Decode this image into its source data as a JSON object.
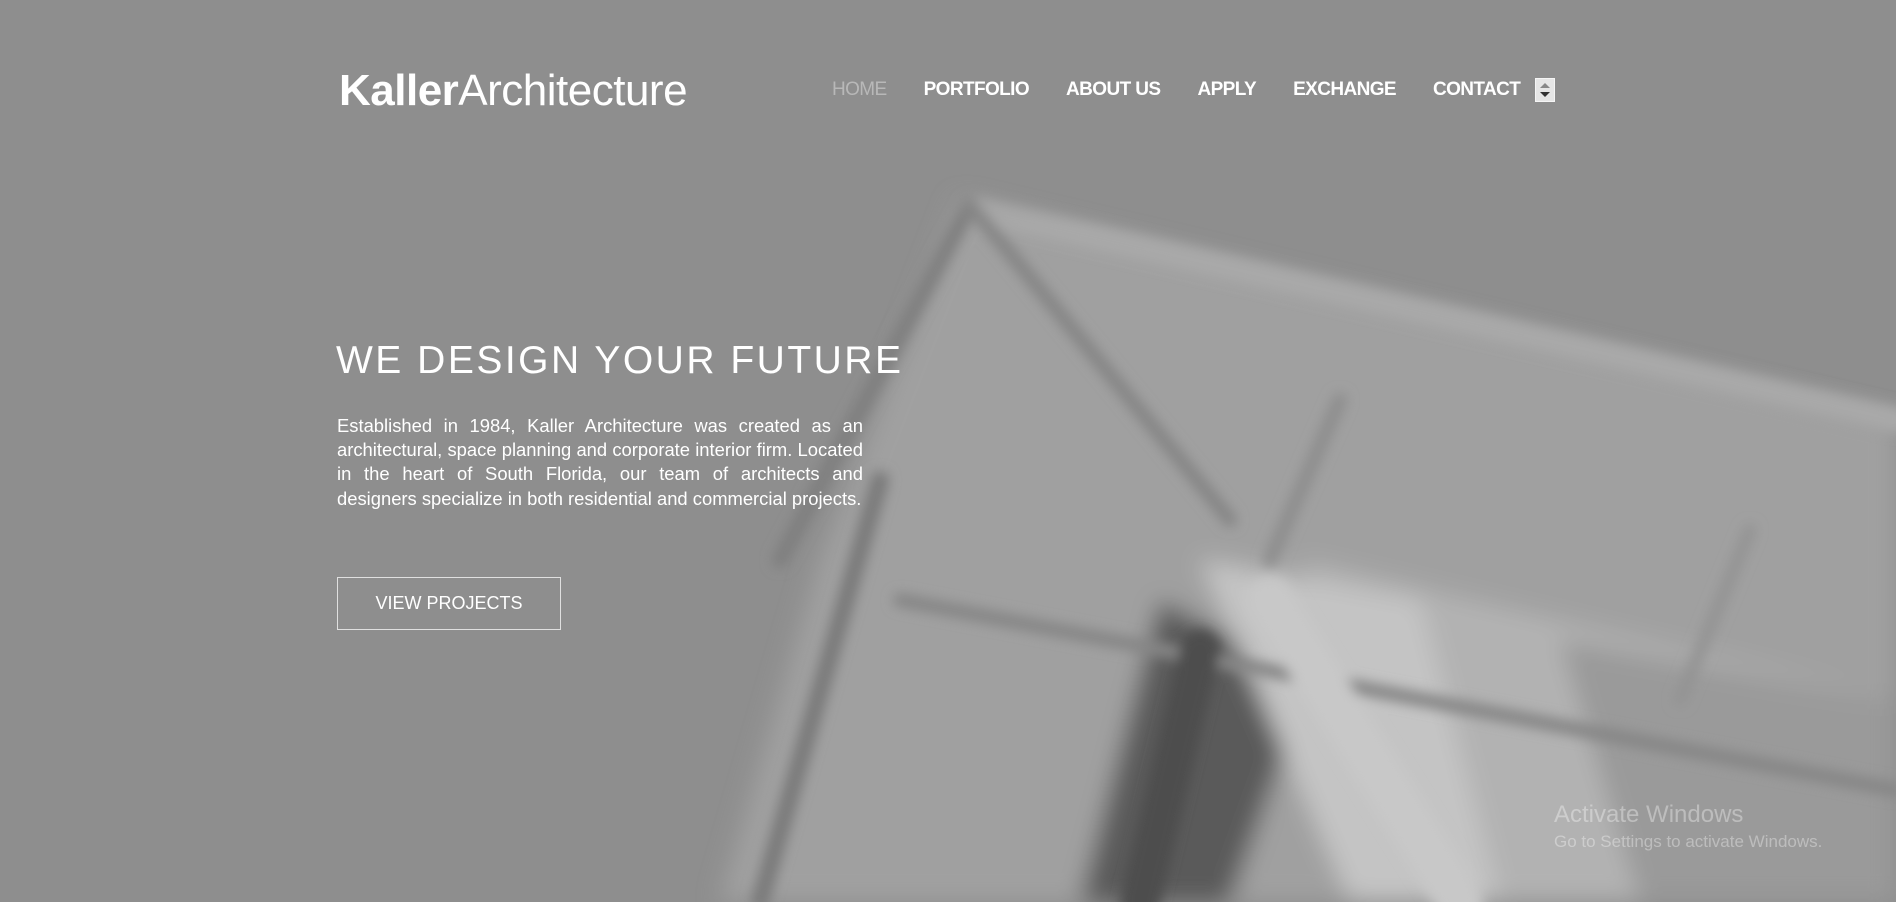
{
  "brand": {
    "name_bold": "Kaller",
    "name_light": "Architecture"
  },
  "nav": {
    "items": [
      {
        "label": "HOME",
        "active": true
      },
      {
        "label": "PORTFOLIO",
        "active": false
      },
      {
        "label": "ABOUT US",
        "active": false
      },
      {
        "label": "APPLY",
        "active": false
      },
      {
        "label": "EXCHANGE",
        "active": false
      },
      {
        "label": "CONTACT",
        "active": false
      }
    ]
  },
  "hero": {
    "headline": "WE DESIGN YOUR FUTURE",
    "intro": "Established in 1984, Kaller Architecture was created as an architectural, space planning and corporate interior firm. Located in the heart of South Florida, our team of architects and designers specialize in both residential and commercial projects.",
    "cta_label": "VIEW PROJECTS"
  },
  "watermark": {
    "title": "Activate Windows",
    "subtitle": "Go to Settings to activate Windows."
  },
  "colors": {
    "background": "#8e8e8e",
    "text": "#ffffff",
    "nav_active": "#b8b8b8"
  }
}
